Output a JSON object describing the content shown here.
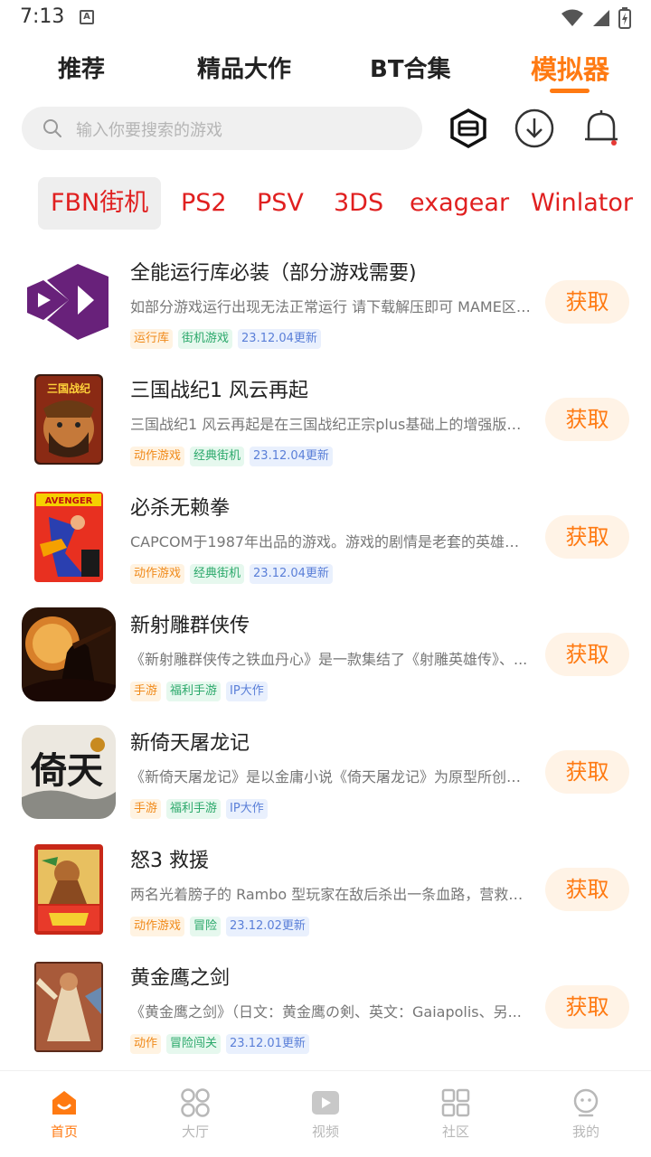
{
  "status": {
    "time": "7:13",
    "notif": "A"
  },
  "top_tabs": [
    "推荐",
    "精品大作",
    "BT合集",
    "模拟器"
  ],
  "search": {
    "placeholder": "输入你要搜索的游戏"
  },
  "emu_tabs": [
    "FBN街机",
    "PS2",
    "PSV",
    "3DS",
    "exagear",
    "Winlator"
  ],
  "get_label": "获取",
  "games": [
    {
      "title": "全能运行库必装（部分游戏需要)",
      "desc": "如部分游戏运行出现无法正常运行 请下载解压即可 MAME区 ...",
      "tags": [
        "运行库",
        "街机游戏",
        "23.12.04更新"
      ]
    },
    {
      "title": "三国战纪1 风云再起",
      "desc": "三国战纪1 风云再起是在三国战纪正宗plus基础上的增强版，...",
      "tags": [
        "动作游戏",
        "经典街机",
        "23.12.04更新"
      ]
    },
    {
      "title": "必杀无赖拳",
      "desc": "CAPCOM于1987年出品的游戏。游戏的剧情是老套的英雄救...",
      "tags": [
        "动作游戏",
        "经典街机",
        "23.12.04更新"
      ]
    },
    {
      "title": "新射雕群侠传",
      "desc": "《新射雕群侠传之铁血丹心》是一款集结了《射雕英雄传》、...",
      "tags": [
        "手游",
        "福利手游",
        "IP大作"
      ]
    },
    {
      "title": "新倚天屠龙记",
      "desc": "《新倚天屠龙记》是以金庸小说《倚天屠龙记》为原型所创作...",
      "tags": [
        "手游",
        "福利手游",
        "IP大作"
      ]
    },
    {
      "title": "怒3 救援",
      "desc": "两名光着膀子的 Rambo 型玩家在敌后杀出一条血路，营救一...",
      "tags": [
        "动作游戏",
        "冒险",
        "23.12.02更新"
      ]
    },
    {
      "title": "黄金鹰之剑",
      "desc": "《黄金鹰之剑》（日文：黄金鹰の剣、英文：Gaiapolis、另...",
      "tags": [
        "动作",
        "冒险闯关",
        "23.12.01更新"
      ]
    }
  ],
  "icon_art": {
    "avenger_logo": "AVENGER",
    "tiangan_logo": "倚天",
    "sanguo_logo": "三国战纪"
  },
  "bottom_nav": [
    "首页",
    "大厅",
    "视频",
    "社区",
    "我的"
  ],
  "colors": {
    "accent": "#ff7a12",
    "emu_tab": "#e02020",
    "vs_purple": "#68217a"
  }
}
